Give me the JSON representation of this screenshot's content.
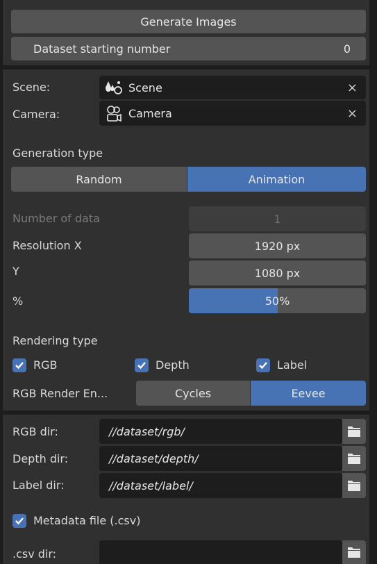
{
  "generate": {
    "label": "Generate Images"
  },
  "dataset_start": {
    "label": "Dataset starting number",
    "value": "0"
  },
  "scene": {
    "label": "Scene:",
    "value": "Scene",
    "clear": "×"
  },
  "camera": {
    "label": "Camera:",
    "value": "Camera",
    "clear": "×"
  },
  "generation": {
    "heading": "Generation type",
    "options": [
      "Random",
      "Animation"
    ],
    "selected": "Animation"
  },
  "number_of_data": {
    "label": "Number of data",
    "value": "1"
  },
  "resolution": {
    "x_label": "Resolution X",
    "x_value": "1920 px",
    "y_label": "Y",
    "y_value": "1080 px",
    "pct_label": "%",
    "pct_value": "50%",
    "pct_fraction": 0.5
  },
  "rendering": {
    "heading": "Rendering type",
    "rgb": "RGB",
    "depth": "Depth",
    "label": "Label",
    "engine_label": "RGB Render En...",
    "engine_options": [
      "Cycles",
      "Eevee"
    ],
    "engine_selected": "Eevee"
  },
  "dirs": {
    "rgb_label": "RGB dir:",
    "rgb_value": "//dataset/rgb/",
    "depth_label": "Depth dir:",
    "depth_value": "//dataset/depth/",
    "label_label": "Label dir:",
    "label_value": "//dataset/label/"
  },
  "metadata": {
    "label": "Metadata file (.csv)",
    "csv_label": ".csv dir:",
    "csv_value": ""
  },
  "colors": {
    "accent": "#4772b3",
    "field": "#545454",
    "panel": "#303030",
    "dark": "#1d1d1d"
  }
}
